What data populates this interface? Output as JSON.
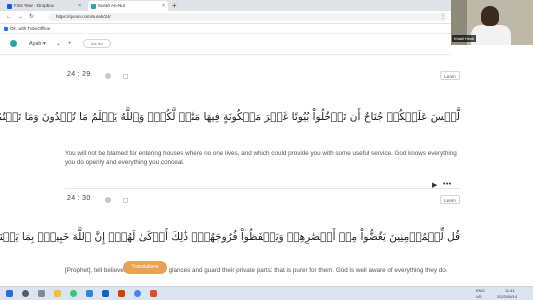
{
  "browser": {
    "tabs": [
      {
        "title": "First Year - Dropbox",
        "active": false,
        "color": "#0061fe"
      },
      {
        "title": "Surah An-Nur",
        "active": true,
        "color": "#2ca4ab"
      }
    ],
    "new_tab": "+",
    "url": "https://quran.com/surah/24/",
    "bookmark": "Ok, with TubeOffline",
    "nav": {
      "back": "←",
      "forward": "→",
      "reload": "↻",
      "extensions": "⋮"
    }
  },
  "webcam": {
    "name": "Khalil Hindi"
  },
  "app": {
    "surah_selector": "Ayah ▾",
    "chev": "⌄",
    "plus": "+",
    "search_label": "Ask Nur"
  },
  "verses": [
    {
      "key": "24 : 29",
      "arabic": "لَّيۡسَ عَلَيۡكُمۡ جُنَاحٌ أَن تَدۡخُلُواْ بُيُوتًا غَيۡرَ مَسۡكُونَةٍ فِيهَا مَتَٰعٞ لَّكُمۡۚ وَٱللَّهُ يَعۡلَمُ مَا تُبۡدُونَ وَمَا تَكۡتُمُونَ",
      "translation": "You will not be blamed for entering houses where no one lives, and which could provide you with some useful service. God knows everything you do openly and everything you conceal.",
      "learn": "Learn"
    },
    {
      "key": "24 : 30",
      "arabic": "قُل لِّلۡمُؤۡمِنِينَ يَغُضُّواْ مِنۡ أَبۡصَٰرِهِمۡ وَيَحۡفَظُواْ فُرُوجَهُمۡۚ ذَٰلِكَ أَزۡكَىٰ لَهُمۡۚ إِنَّ ٱللَّهَ خَبِيرُۢ بِمَا يَصۡنَعُونَ",
      "translation": "[Prophet], tell believers to lower their glances and guard their private parts: that is purer for them. God is well aware of everything they do.",
      "learn": "Learn"
    }
  ],
  "controls": {
    "play": "▶",
    "more": "•••"
  },
  "floating_button": "Translations",
  "taskbar": {
    "time": "11:41",
    "date": "2022/09/14",
    "lang": "ENG",
    "region": "US"
  }
}
